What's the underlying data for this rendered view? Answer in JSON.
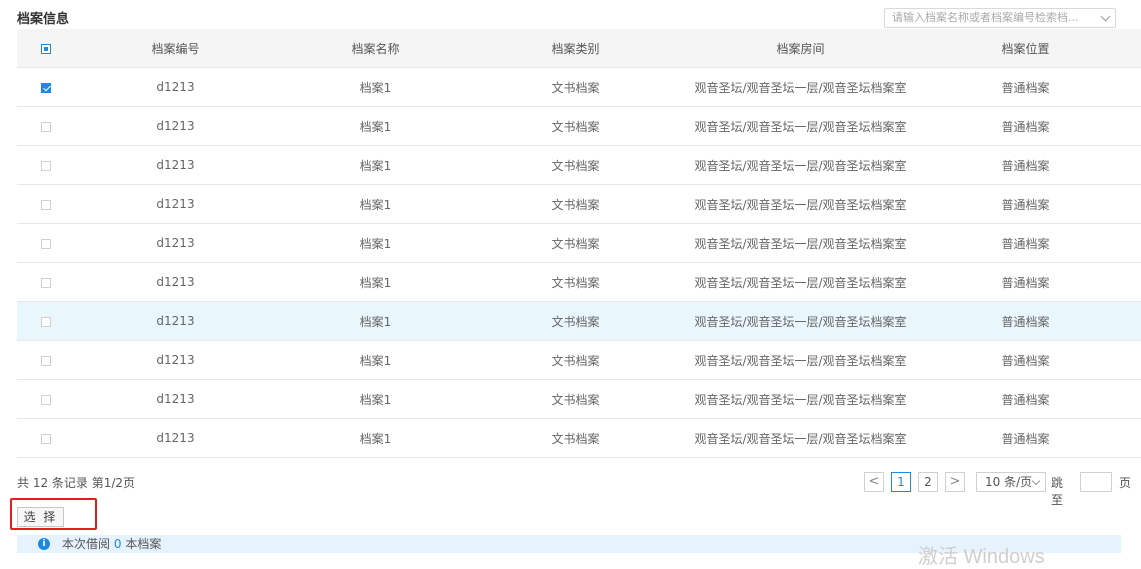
{
  "section_title": "档案信息",
  "search": {
    "placeholder": "请输入档案名称或者档案编号检索档..."
  },
  "table": {
    "headers": [
      "档案编号",
      "档案名称",
      "档案类别",
      "档案房间",
      "档案位置"
    ],
    "header_checkbox_state": "indeterminate",
    "rows": [
      {
        "checked": true,
        "highlighted": false,
        "cells": [
          "d1213",
          "档案1",
          "文书档案",
          "观音圣坛/观音圣坛一层/观音圣坛档案室",
          "普通档案"
        ]
      },
      {
        "checked": false,
        "highlighted": false,
        "cells": [
          "d1213",
          "档案1",
          "文书档案",
          "观音圣坛/观音圣坛一层/观音圣坛档案室",
          "普通档案"
        ]
      },
      {
        "checked": false,
        "highlighted": false,
        "cells": [
          "d1213",
          "档案1",
          "文书档案",
          "观音圣坛/观音圣坛一层/观音圣坛档案室",
          "普通档案"
        ]
      },
      {
        "checked": false,
        "highlighted": false,
        "cells": [
          "d1213",
          "档案1",
          "文书档案",
          "观音圣坛/观音圣坛一层/观音圣坛档案室",
          "普通档案"
        ]
      },
      {
        "checked": false,
        "highlighted": false,
        "cells": [
          "d1213",
          "档案1",
          "文书档案",
          "观音圣坛/观音圣坛一层/观音圣坛档案室",
          "普通档案"
        ]
      },
      {
        "checked": false,
        "highlighted": false,
        "cells": [
          "d1213",
          "档案1",
          "文书档案",
          "观音圣坛/观音圣坛一层/观音圣坛档案室",
          "普通档案"
        ]
      },
      {
        "checked": false,
        "highlighted": true,
        "cells": [
          "d1213",
          "档案1",
          "文书档案",
          "观音圣坛/观音圣坛一层/观音圣坛档案室",
          "普通档案"
        ]
      },
      {
        "checked": false,
        "highlighted": false,
        "cells": [
          "d1213",
          "档案1",
          "文书档案",
          "观音圣坛/观音圣坛一层/观音圣坛档案室",
          "普通档案"
        ]
      },
      {
        "checked": false,
        "highlighted": false,
        "cells": [
          "d1213",
          "档案1",
          "文书档案",
          "观音圣坛/观音圣坛一层/观音圣坛档案室",
          "普通档案"
        ]
      },
      {
        "checked": false,
        "highlighted": false,
        "cells": [
          "d1213",
          "档案1",
          "文书档案",
          "观音圣坛/观音圣坛一层/观音圣坛档案室",
          "普通档案"
        ]
      }
    ]
  },
  "footer": {
    "summary": "共 12 条记录 第1/2页",
    "pagination": {
      "prev": "<",
      "pages": [
        "1",
        "2"
      ],
      "current_page": "1",
      "next": ">",
      "page_size": "10 条/页",
      "jump_label": "跳至",
      "jump_value": "",
      "page_unit": "页"
    }
  },
  "select_button": "选 择",
  "notice": {
    "prefix": "本次借阅",
    "count": "0",
    "suffix": "本档案"
  },
  "watermark": "激活 Windows",
  "colors": {
    "accent": "#1e88e5",
    "highlight_row": "#e9f6fc",
    "header_bg": "#f5f5f5",
    "alert_border": "#e02020",
    "notice_bg": "#e6f3fd"
  },
  "icons": {
    "info": "info-icon",
    "search_dropdown": "chevron-down-icon"
  }
}
